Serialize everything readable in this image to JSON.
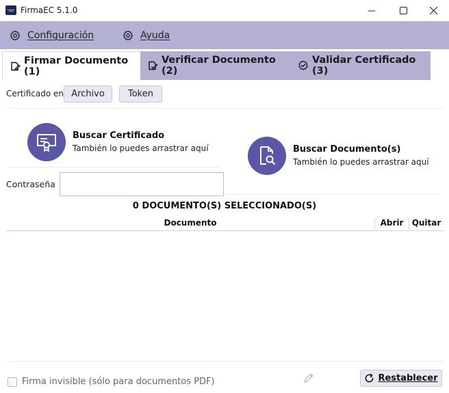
{
  "window": {
    "title": "FirmaEC 5.1.0",
    "icons": {
      "app": "firmaec-app-icon",
      "minimize": "minimize-icon",
      "maximize": "maximize-icon",
      "close": "close-icon"
    }
  },
  "menu": {
    "configuracion": {
      "label": "Configuración",
      "icon": "gear-icon"
    },
    "ayuda": {
      "label": "Ayuda",
      "icon": "gear-icon"
    }
  },
  "tabs": [
    {
      "label": "Firmar Documento (1)",
      "icon": "edit-document-icon",
      "active": true
    },
    {
      "label": "Verificar Documento (2)",
      "icon": "check-document-icon",
      "active": false
    },
    {
      "label": "Validar Certificado (3)",
      "icon": "verified-badge-icon",
      "active": false
    }
  ],
  "certificate": {
    "source_label": "Certificado en",
    "archivo_button": "Archivo",
    "token_button": "Token",
    "search_title": "Buscar Certificado",
    "search_hint": "También lo puedes arrastrar aquí",
    "password_label": "Contraseña",
    "password_value": ""
  },
  "documents": {
    "search_title": "Buscar Documento(s)",
    "search_hint": "También lo puedes arrastrar aquí",
    "count_label": "0 DOCUMENTO(S) SELECCIONADO(S)",
    "columns": [
      "Documento",
      "Abrir",
      "Quitar"
    ],
    "rows": []
  },
  "footer": {
    "invisible_signature_label": "Firma invisible (sólo para documentos PDF)",
    "invisible_signature_checked": false,
    "reset_button": "Restablecer"
  },
  "colors": {
    "menu_bg": "#b3b0d3",
    "accent_circle": "#5a56a8",
    "button_bg": "#e9e8f2"
  }
}
